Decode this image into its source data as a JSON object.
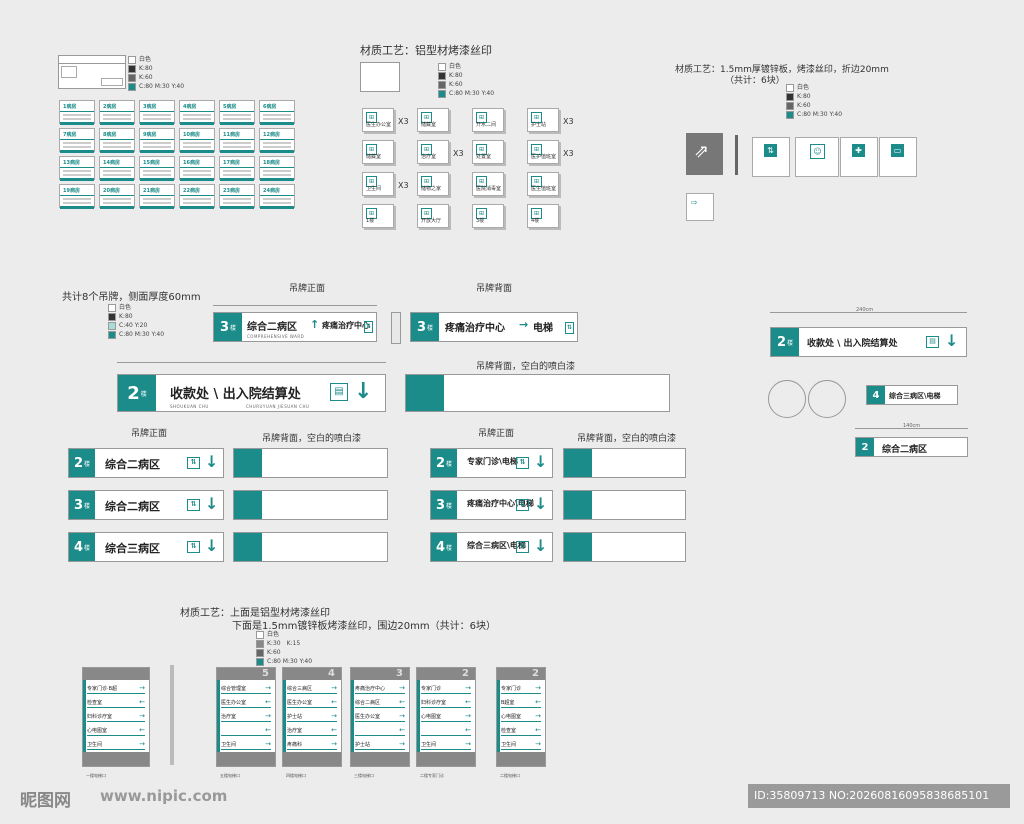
{
  "colors": {
    "teal": "#1c8c8a",
    "grey": "#888888",
    "bg": "#ececec"
  },
  "legend_a": [
    "白色",
    "K:80",
    "K:60",
    "C:80 M:30 Y:40"
  ],
  "legend_b": [
    "白色",
    "K:80",
    "K:60",
    "C:80 M:30 Y:40"
  ],
  "legend_c": [
    "白色",
    "K:80",
    "K:60",
    "C:80 M:30 Y:40"
  ],
  "legend_d": [
    "白色",
    "K:80",
    "C:40 Y:20",
    "C:80 M:30 Y:40"
  ],
  "legend_e": [
    "白色",
    "K:30",
    "K:15",
    "K:60",
    "C:80 M:30 Y:40"
  ],
  "wards": [
    "1病房",
    "2病房",
    "3病房",
    "4病房",
    "5病房",
    "6病房",
    "7病房",
    "8病房",
    "9病房",
    "10病房",
    "11病房",
    "12病房",
    "13病房",
    "14病房",
    "15病房",
    "16病房",
    "17病房",
    "18病房",
    "19病房",
    "20病房",
    "21病房",
    "22病房",
    "23病房",
    "24病房"
  ],
  "titles": {
    "mat1": "材质工艺：铝型材烤漆丝印",
    "mat2": "材质工艺：1.5mm厚镀锌板，烤漆丝印，折边20mm",
    "mat2b": "（共计：6块）",
    "hang_total": "共计8个吊牌，侧面厚度60mm",
    "front1": "吊牌正面",
    "back1": "吊牌背面",
    "back_paint": "吊牌背面，空白的喷白漆",
    "front2": "吊牌正面",
    "back2": "吊牌背面，空白的喷白漆",
    "front3": "吊牌正面",
    "back3": "吊牌背面，空白的喷白漆",
    "mat3": "材质工艺：上面是铝型材烤漆丝印",
    "mat3b": "下面是1.5mm镀锌板烤漆丝印，围边20mm（共计：6块）"
  },
  "doors": [
    {
      "label": "医生办公室",
      "x3": "X3"
    },
    {
      "label": "储藏室",
      "x3": ""
    },
    {
      "label": "开水二间",
      "x3": ""
    },
    {
      "label": "护士站",
      "x3": "X3"
    },
    {
      "label": "储藏室",
      "x3": ""
    },
    {
      "label": "治疗室",
      "x3": "X3"
    },
    {
      "label": "处置室",
      "x3": ""
    },
    {
      "label": "医护值班室",
      "x3": "X3"
    },
    {
      "label": "卫生间",
      "x3": "X3"
    },
    {
      "label": "储物之家",
      "x3": ""
    },
    {
      "label": "医院消毒室",
      "x3": ""
    },
    {
      "label": "医生值班室",
      "x3": ""
    },
    {
      "label": "1楼",
      "x3": ""
    },
    {
      "label": "开放大厅",
      "x3": ""
    },
    {
      "label": "3楼",
      "x3": ""
    },
    {
      "label": "4楼",
      "x3": ""
    }
  ],
  "hang_top": {
    "floor": "3",
    "sub": "楼",
    "text_a": "综合二病区",
    "text_b": "疼痛治疗中心",
    "sub_a": "COMPREHENSIVE WARD",
    "back_floor": "3",
    "back_text": "疼痛治疗中心",
    "back_text2": "电梯"
  },
  "hang_big": {
    "floor": "2",
    "sub": "楼",
    "text": "收款处 \\ 出入院结算处",
    "sub_text": "SHOUKUAN CHU",
    "sub2": "CHURUYUAN JIESUAN CHU"
  },
  "hang_left": [
    {
      "floor": "2",
      "text": "综合二病区"
    },
    {
      "floor": "3",
      "text": "综合二病区"
    },
    {
      "floor": "4",
      "text": "综合三病区"
    }
  ],
  "hang_mid": [
    {
      "floor": "2",
      "text": "专家门诊\\电梯"
    },
    {
      "floor": "3",
      "text": "疼痛治疗中心\\电梯"
    },
    {
      "floor": "4",
      "text": "综合三病区\\电梯"
    }
  ],
  "right_signs": {
    "main_floor": "2",
    "main_text": "收款处 \\ 出入院结算处",
    "small_floor": "4",
    "small_text": "综合三病区\\电梯",
    "small2_floor": "2",
    "small2_text": "综合二病区",
    "dim1": "240cm",
    "dim2": "140cm"
  },
  "dirs": [
    {
      "floor": "",
      "rows": [
        "专家门诊·B超",
        "检查室",
        "妇科诊疗室",
        "心电图室",
        "卫生间"
      ]
    },
    {
      "floor": "5",
      "rows": [
        "综合管理室",
        "医生办公室",
        "治疗室",
        "",
        "卫生间"
      ]
    },
    {
      "floor": "4",
      "rows": [
        "综合三病区",
        "医生办公室",
        "护士站",
        "治疗室",
        "疼痛科"
      ]
    },
    {
      "floor": "3",
      "rows": [
        "疼痛治疗中心",
        "综合二病区",
        "医生办公室",
        "",
        "护士站"
      ]
    },
    {
      "floor": "2",
      "rows": [
        "专家门诊",
        "妇科诊疗室",
        "心电图室",
        "",
        "卫生间"
      ]
    },
    {
      "floor": "2",
      "rows": [
        "专家门诊",
        "B超室",
        "心电图室",
        "检查室",
        "卫生间"
      ]
    }
  ],
  "dir_caps": [
    "一楼电梯口",
    "五楼电梯口",
    "四楼电梯口",
    "三楼电梯口",
    "二楼专家门诊",
    "二楼电梯口"
  ],
  "watermark": {
    "logo": "昵图网",
    "url": "www.nipic.com",
    "id": "ID:35809713 NO:20260816095838685101"
  }
}
